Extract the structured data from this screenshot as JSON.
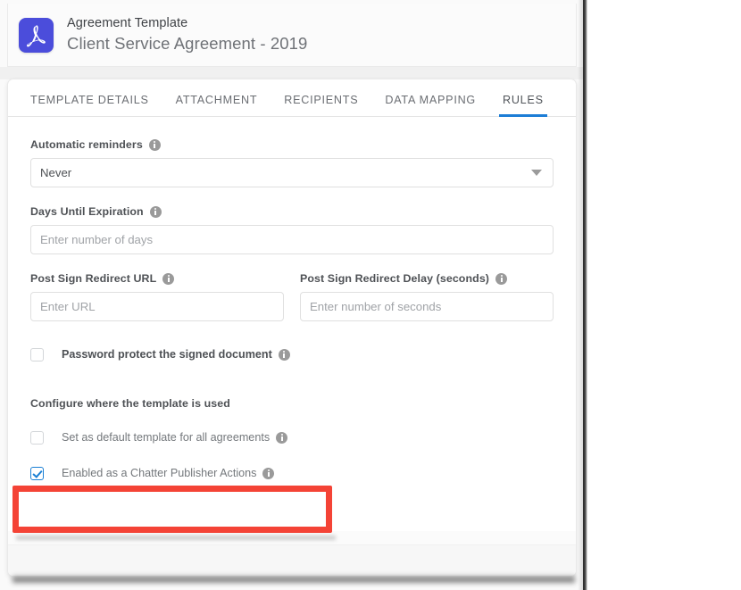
{
  "header": {
    "icon": "pdf-document-icon",
    "icon_color": "#4b4ddb",
    "kicker": "Agreement Template",
    "title": "Client Service Agreement - 2019"
  },
  "tabs": {
    "active_index": 4,
    "accent_color": "#1d7dd6",
    "items": [
      {
        "label": "TEMPLATE DETAILS"
      },
      {
        "label": "ATTACHMENT"
      },
      {
        "label": "RECIPIENTS"
      },
      {
        "label": "DATA MAPPING"
      },
      {
        "label": "RULES"
      }
    ]
  },
  "form": {
    "automatic_reminders": {
      "label": "Automatic reminders",
      "info": "info-icon",
      "value": "Never",
      "caret": "chevron-down-icon"
    },
    "days_until_expiration": {
      "label": "Days Until Expiration",
      "info": "info-icon",
      "value": "",
      "placeholder": "Enter number of days"
    },
    "post_sign_redirect_url": {
      "label": "Post Sign Redirect URL",
      "info": "info-icon",
      "value": "",
      "placeholder": "Enter URL"
    },
    "post_sign_redirect_delay": {
      "label": "Post Sign Redirect Delay (seconds)",
      "info": "info-icon",
      "value": "",
      "placeholder": "Enter number of seconds"
    },
    "password_protect": {
      "label": "Password protect the signed document",
      "checked": false,
      "info": "info-icon"
    },
    "configure_section": {
      "title": "Configure where the template is used",
      "set_default": {
        "label": "Set as default template for all agreements",
        "checked": false,
        "info": "info-icon"
      },
      "chatter_publisher": {
        "label": "Enabled as a Chatter Publisher Actions",
        "checked": true,
        "info": "info-icon"
      }
    }
  },
  "annotation": {
    "highlight_color": "#f44336",
    "target": "Enabled as a Chatter Publisher Actions"
  }
}
